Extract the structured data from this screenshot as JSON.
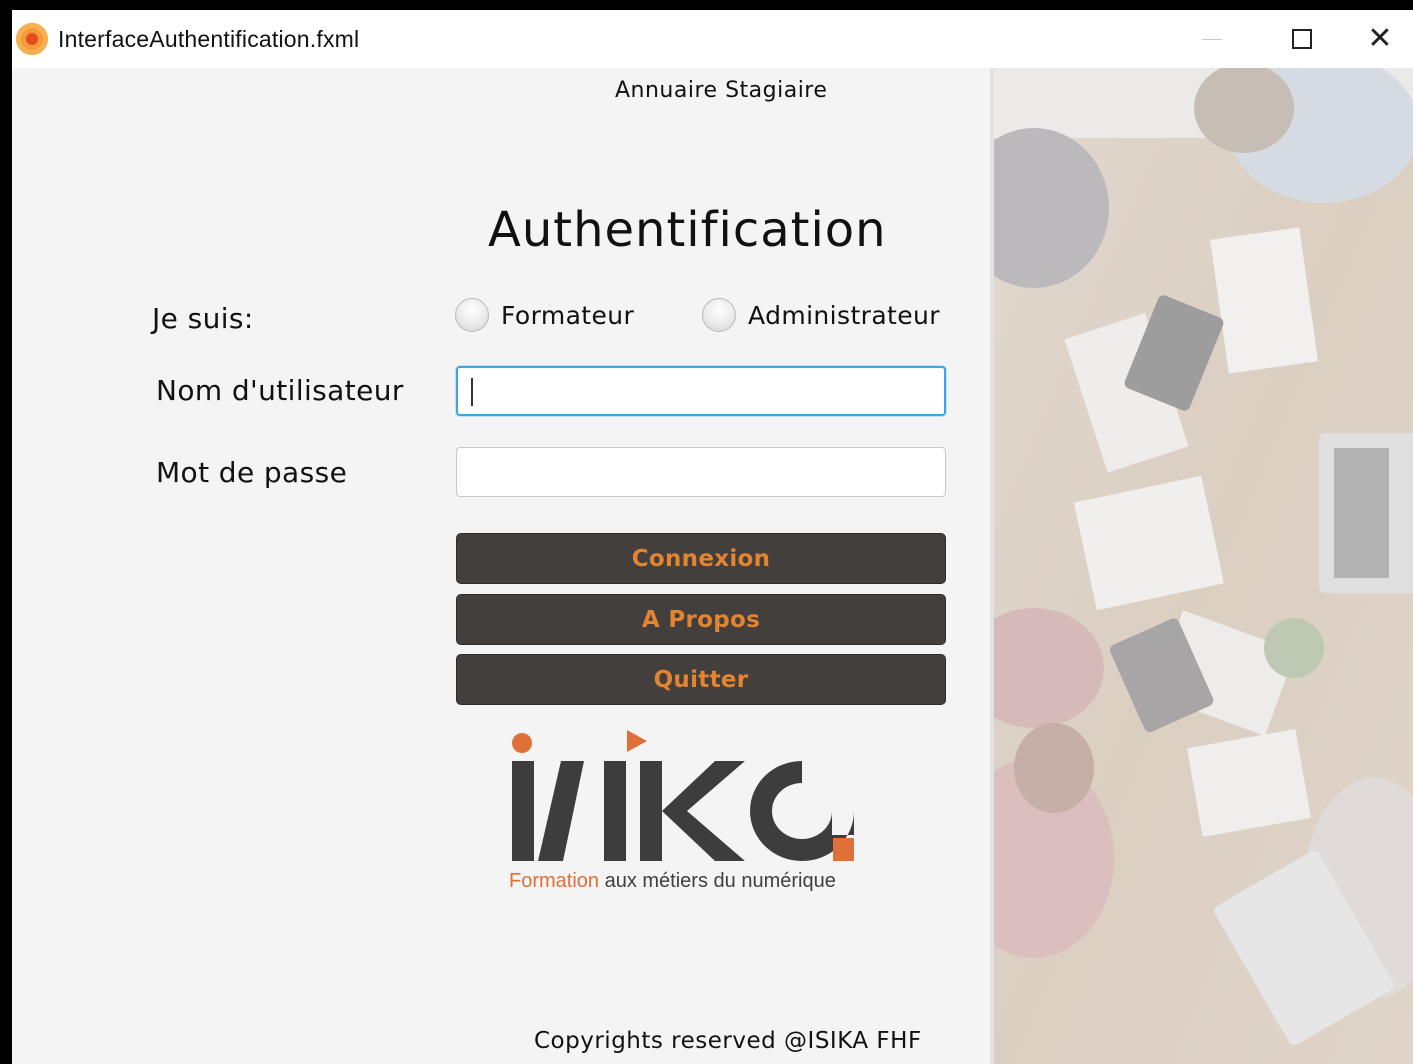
{
  "window": {
    "title": "InterfaceAuthentification.fxml",
    "icon": "java-app-icon"
  },
  "header": {
    "app_name": "Annuaire Stagiaire",
    "heading": "Authentification"
  },
  "form": {
    "role_label": "Je suis:",
    "roles": [
      {
        "label": "Formateur",
        "selected": false
      },
      {
        "label": "Administrateur",
        "selected": false
      }
    ],
    "username_label": "Nom d'utilisateur",
    "username_value": "",
    "password_label": "Mot de passe",
    "password_value": ""
  },
  "buttons": {
    "connexion": "Connexion",
    "apropos": "A Propos",
    "quitter": "Quitter"
  },
  "logo": {
    "wordmark": "isika",
    "tagline_accent": "Formation",
    "tagline_rest": " aux métiers du numérique"
  },
  "footer": {
    "copyright": "Copyrights reserved @ISIKA FHF"
  },
  "colors": {
    "button_bg": "#433f3d",
    "button_text": "#e38431",
    "focus_border": "#3da6df",
    "logo_dark": "#3d3d3d",
    "logo_accent": "#e0703a"
  }
}
